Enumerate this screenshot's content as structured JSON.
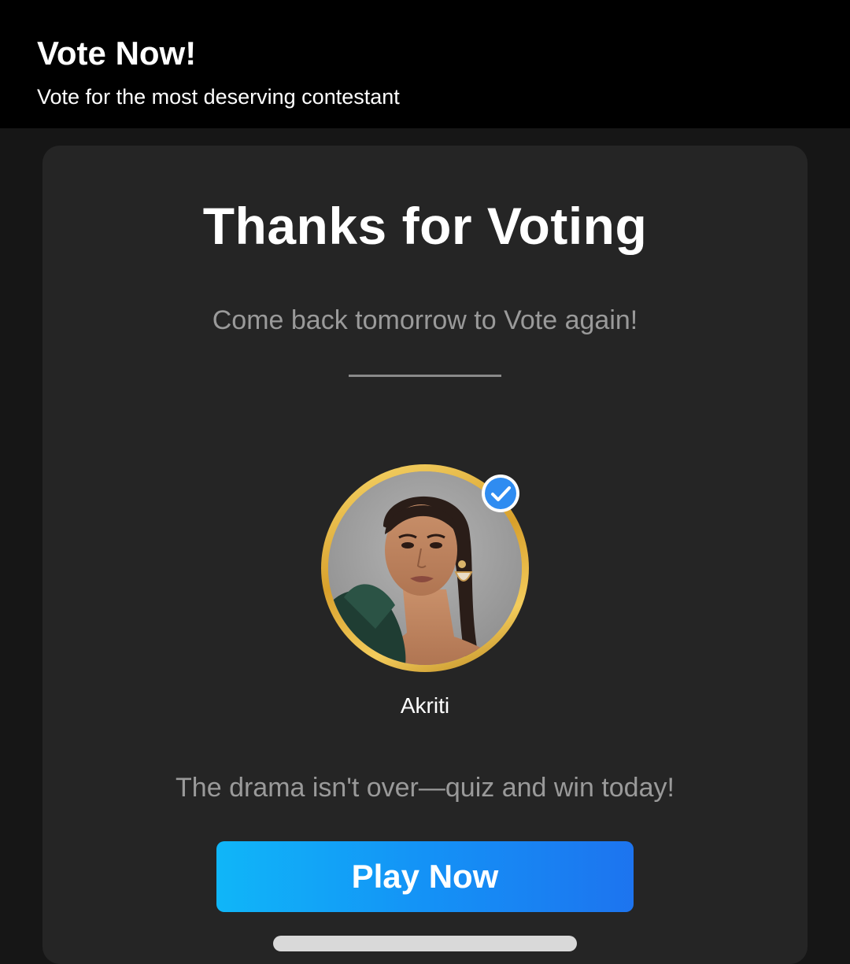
{
  "header": {
    "title": "Vote Now!",
    "subtitle": "Vote for the most deserving contestant"
  },
  "card": {
    "title": "Thanks for Voting",
    "message": "Come back tomorrow to Vote again!",
    "contestant": {
      "name": "Akriti",
      "verified": true,
      "ring_color": "#E2AE36",
      "badge_color": "#2F8CF1"
    },
    "promo_text": "The drama isn't over—quiz and win today!",
    "play_button_label": "Play Now"
  },
  "colors": {
    "background": "#161616",
    "header_background": "#000000",
    "card_background": "#252525",
    "button_gradient_start": "#10B6F8",
    "button_gradient_end": "#1D74EF"
  }
}
